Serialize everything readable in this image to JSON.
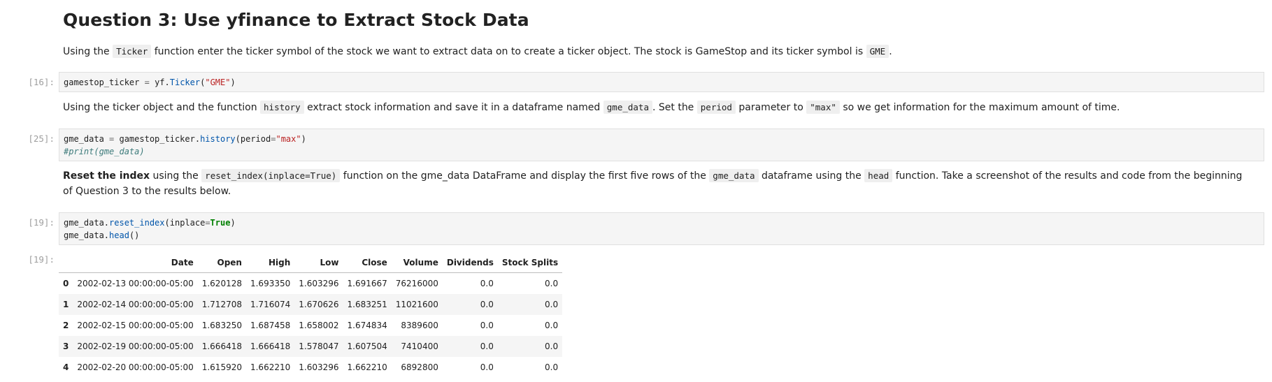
{
  "heading": "Question 3: Use yfinance to Extract Stock Data",
  "md1": {
    "t1": "Using the",
    "c1": "Ticker",
    "t2": "function enter the ticker symbol of the stock we want to extract data on to create a ticker object. The stock is GameStop and its ticker symbol is",
    "c2": "GME",
    "t3": "."
  },
  "cell16": {
    "prompt": "[16]:",
    "line1": {
      "var": "gamestop_ticker",
      "eq": " = ",
      "obj": "yf.",
      "fn": "Ticker",
      "open": "(",
      "str": "\"GME\"",
      "close": ")"
    }
  },
  "md2": {
    "t1": "Using the ticker object and the function",
    "c1": "history",
    "t2": "extract stock information and save it in a dataframe named",
    "c2": "gme_data",
    "t3": ". Set the",
    "c3": "period",
    "t4": "parameter to",
    "c4": "\"max\"",
    "t5": "so we get information for the maximum amount of time."
  },
  "cell25": {
    "prompt": "[25]:",
    "line1": {
      "var": "gme_data",
      "eq": " = ",
      "obj": "gamestop_ticker.",
      "fn": "history",
      "open": "(period",
      "eq2": "=",
      "str": "\"max\"",
      "close": ")"
    },
    "line2": "#print(gme_data)"
  },
  "md3": {
    "b1": "Reset the index",
    "t1": "using the",
    "c1": "reset_index(inplace=True)",
    "t2": "function on the gme_data DataFrame and display the first five rows of the",
    "c2": "gme_data",
    "t3": "dataframe using the",
    "c3": "head",
    "t4": "function. Take a screenshot of the results and code from the beginning of Question 3 to the results below."
  },
  "cell19": {
    "prompt": "[19]:",
    "line1": {
      "obj": "gme_data.",
      "fn": "reset_index",
      "open": "(inplace",
      "eq": "=",
      "kw": "True",
      "close": ")"
    },
    "line2": {
      "obj": "gme_data.",
      "fn": "head",
      "close": "()"
    }
  },
  "output19": {
    "prompt": "[19]:",
    "columns": [
      "",
      "Date",
      "Open",
      "High",
      "Low",
      "Close",
      "Volume",
      "Dividends",
      "Stock Splits"
    ],
    "rows": [
      [
        "0",
        "2002-02-13 00:00:00-05:00",
        "1.620128",
        "1.693350",
        "1.603296",
        "1.691667",
        "76216000",
        "0.0",
        "0.0"
      ],
      [
        "1",
        "2002-02-14 00:00:00-05:00",
        "1.712708",
        "1.716074",
        "1.670626",
        "1.683251",
        "11021600",
        "0.0",
        "0.0"
      ],
      [
        "2",
        "2002-02-15 00:00:00-05:00",
        "1.683250",
        "1.687458",
        "1.658002",
        "1.674834",
        "8389600",
        "0.0",
        "0.0"
      ],
      [
        "3",
        "2002-02-19 00:00:00-05:00",
        "1.666418",
        "1.666418",
        "1.578047",
        "1.607504",
        "7410400",
        "0.0",
        "0.0"
      ],
      [
        "4",
        "2002-02-20 00:00:00-05:00",
        "1.615920",
        "1.662210",
        "1.603296",
        "1.662210",
        "6892800",
        "0.0",
        "0.0"
      ]
    ]
  }
}
